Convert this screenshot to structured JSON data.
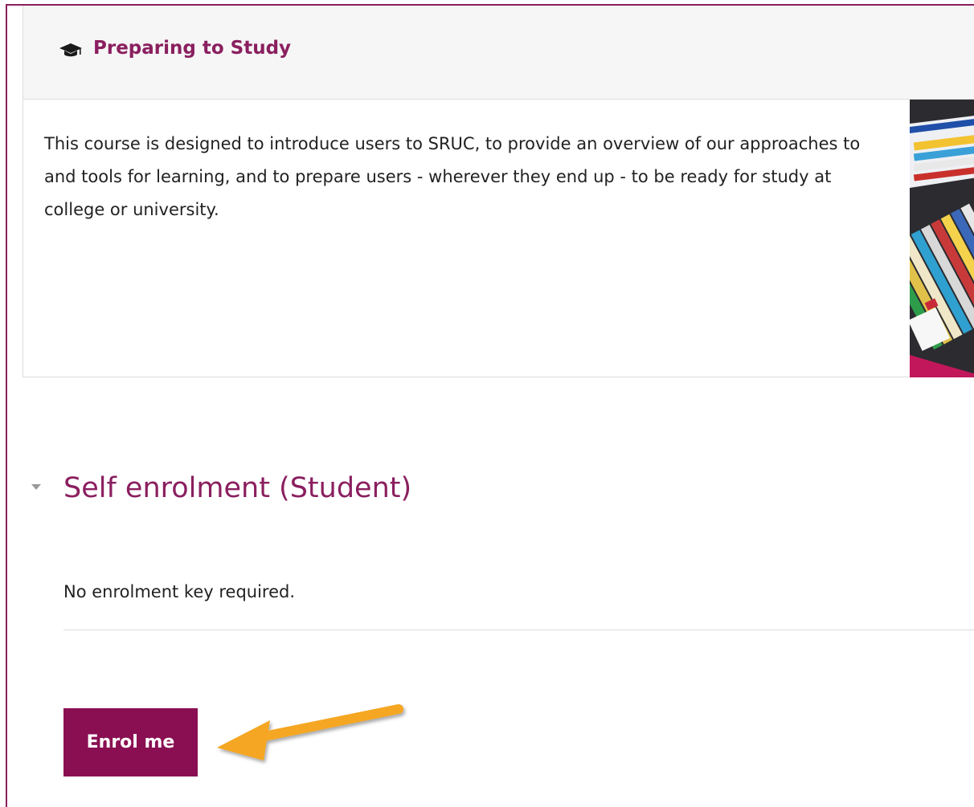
{
  "course": {
    "title": "Preparing to Study",
    "title_icon": "graduation-cap-icon",
    "summary": "This course is designed to introduce users to SRUC, to provide an overview of our approaches to and tools for learning, and to prepare users - wherever they end up - to be ready for study at college or university."
  },
  "enrolment": {
    "section_title": "Self enrolment (Student)",
    "toggle_icon": "caret-down-icon",
    "key_note": "No enrolment key required.",
    "button_label": "Enrol me"
  },
  "annotation": {
    "icon": "arrow-left-icon",
    "color": "#f5a623"
  },
  "colors": {
    "brand": "#8a1f5f",
    "button": "#8a0f52",
    "header_bg": "#f6f6f6"
  }
}
